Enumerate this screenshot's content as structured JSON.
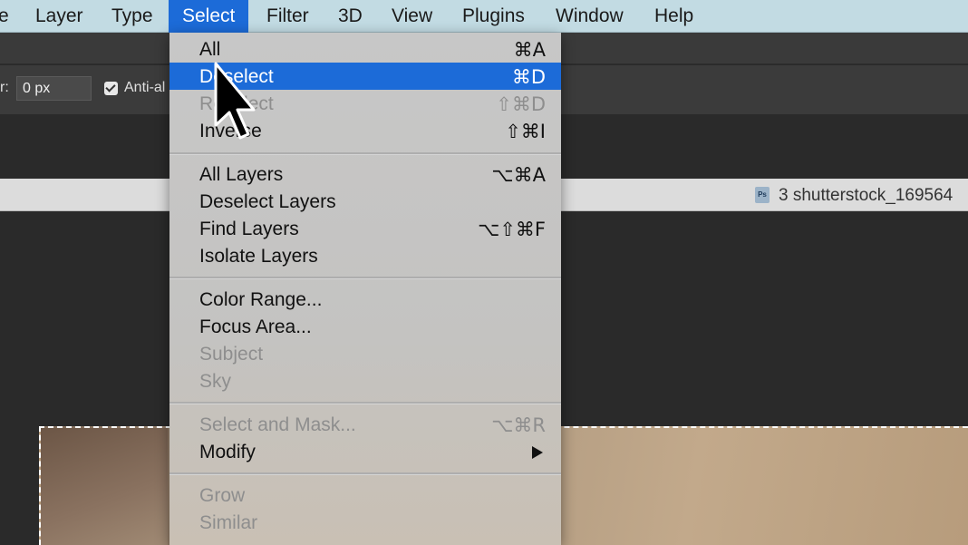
{
  "menubar": {
    "items": [
      {
        "label": "e"
      },
      {
        "label": "Layer"
      },
      {
        "label": "Type"
      },
      {
        "label": "Select"
      },
      {
        "label": "Filter"
      },
      {
        "label": "3D"
      },
      {
        "label": "View"
      },
      {
        "label": "Plugins"
      },
      {
        "label": "Window"
      },
      {
        "label": "Help"
      }
    ],
    "active": "Select"
  },
  "options": {
    "feather_label": "r:",
    "feather_value": "0 px",
    "antialias_label": "Anti-al",
    "antialias_checked": true
  },
  "document": {
    "tab_icon": "Ps",
    "tab_title": "3 shutterstock_169564"
  },
  "select_menu": {
    "items": [
      {
        "label": "All",
        "shortcut": "⌘A",
        "enabled": true
      },
      {
        "label": "Deselect",
        "shortcut": "⌘D",
        "enabled": true,
        "highlighted": true
      },
      {
        "label": "Reselect",
        "shortcut": "⇧⌘D",
        "enabled": false
      },
      {
        "label": "Inverse",
        "shortcut": "⇧⌘I",
        "enabled": true
      },
      {
        "label": "All Layers",
        "shortcut": "⌥⌘A",
        "enabled": true
      },
      {
        "label": "Deselect Layers",
        "shortcut": "",
        "enabled": true
      },
      {
        "label": "Find Layers",
        "shortcut": "⌥⇧⌘F",
        "enabled": true
      },
      {
        "label": "Isolate Layers",
        "shortcut": "",
        "enabled": true
      },
      {
        "label": "Color Range...",
        "shortcut": "",
        "enabled": true
      },
      {
        "label": "Focus Area...",
        "shortcut": "",
        "enabled": true
      },
      {
        "label": "Subject",
        "shortcut": "",
        "enabled": false
      },
      {
        "label": "Sky",
        "shortcut": "",
        "enabled": false
      },
      {
        "label": "Select and Mask...",
        "shortcut": "⌥⌘R",
        "enabled": false
      },
      {
        "label": "Modify",
        "shortcut": "",
        "enabled": true,
        "submenu": true
      },
      {
        "label": "Grow",
        "shortcut": "",
        "enabled": false
      },
      {
        "label": "Similar",
        "shortcut": "",
        "enabled": false
      }
    ]
  },
  "colors": {
    "menubar": "#c2dbe3",
    "highlight": "#1c6bd8",
    "menu_bg": "#c7c7c7",
    "app_bg": "#2a2a2a"
  }
}
